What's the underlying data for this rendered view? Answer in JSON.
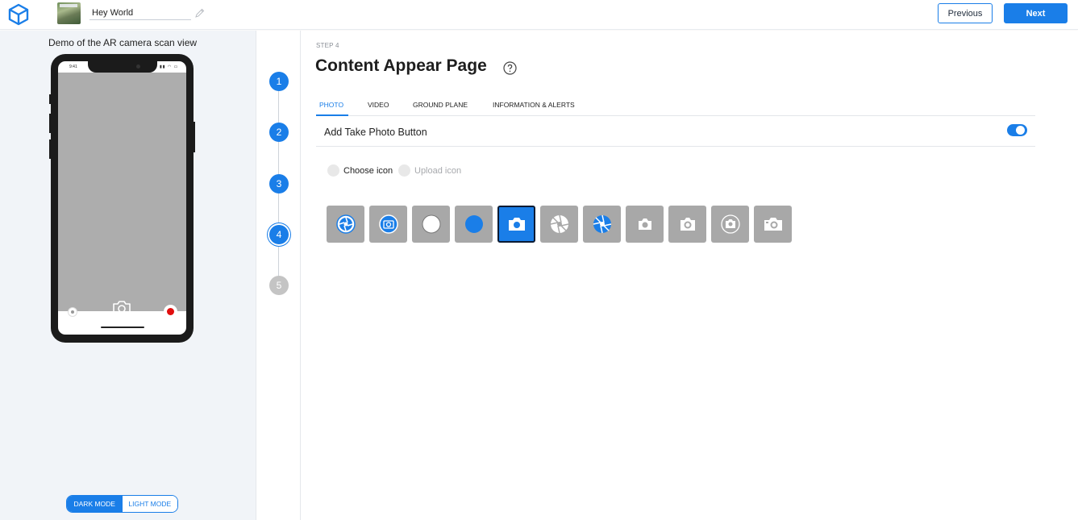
{
  "header": {
    "project_name": "Hey World",
    "previous_label": "Previous",
    "next_label": "Next"
  },
  "preview": {
    "caption": "Demo of the AR camera scan view",
    "status_time": "9:41",
    "modes": {
      "dark": "DARK MODE",
      "light": "LIGHT MODE",
      "selected": "dark"
    }
  },
  "stepper": {
    "steps": [
      "1",
      "2",
      "3",
      "4",
      "5"
    ],
    "current": "4"
  },
  "main": {
    "step_label": "STEP 4",
    "title": "Content Appear Page",
    "tabs": [
      "PHOTO",
      "VIDEO",
      "GROUND PLANE",
      "INFORMATION & ALERTS"
    ],
    "active_tab": "PHOTO",
    "setting": {
      "label": "Add Take Photo Button",
      "enabled": true
    },
    "icon_source": {
      "choose_label": "Choose icon",
      "upload_label": "Upload icon"
    },
    "icons": [
      "blue-aperture-icon",
      "blue-camera-outline-icon",
      "white-circle-icon",
      "blue-dot-icon",
      "camera-icon",
      "white-aperture-icon",
      "blue-white-aperture-icon",
      "white-camera-icon",
      "white-camera-circle-icon",
      "white-camera-ring-icon",
      "white-camera-large-icon"
    ],
    "selected_icon": "camera-icon"
  },
  "colors": {
    "accent": "#1a7ee8",
    "camera_view": "#adadad",
    "tile_bg": "#a8a8a8",
    "record": "#e10e0e"
  }
}
